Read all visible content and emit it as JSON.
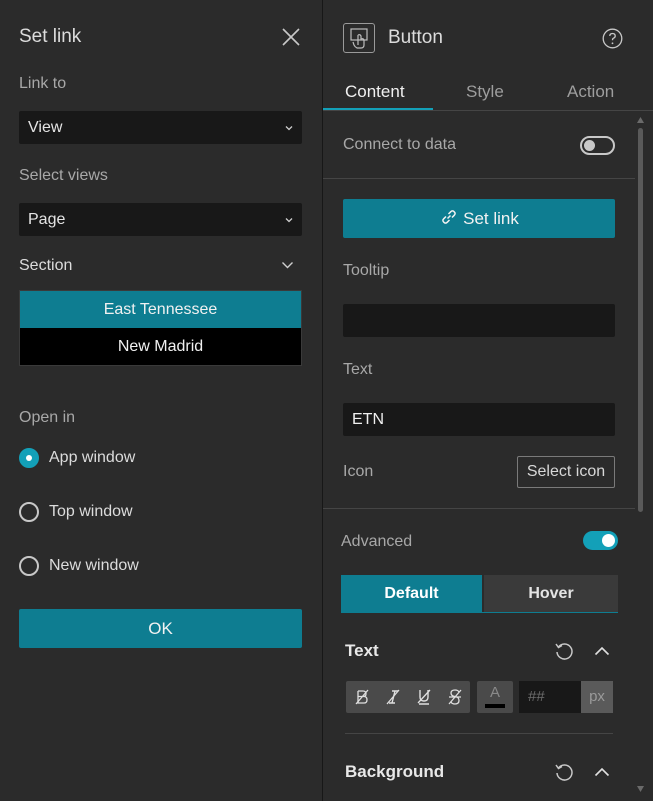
{
  "set_link": {
    "title": "Set link",
    "link_to_label": "Link to",
    "link_to_value": "View",
    "select_views_label": "Select views",
    "select_views_value": "Page",
    "section_label": "Section",
    "sections": [
      "East Tennessee",
      "New Madrid"
    ],
    "selected_section": "East Tennessee",
    "open_in_label": "Open in",
    "open_in_options": [
      "App window",
      "Top window",
      "New window"
    ],
    "open_in_selected": "App window",
    "ok_label": "OK"
  },
  "button_panel": {
    "title": "Button",
    "tabs": [
      "Content",
      "Style",
      "Action"
    ],
    "active_tab": "Content",
    "connect_to_data_label": "Connect to data",
    "connect_to_data_enabled": false,
    "set_link_label": "Set link",
    "tooltip_label": "Tooltip",
    "tooltip_value": "",
    "text_label": "Text",
    "text_value": "ETN",
    "icon_label": "Icon",
    "select_icon_label": "Select icon",
    "advanced_label": "Advanced",
    "advanced_enabled": true,
    "states": [
      "Default",
      "Hover"
    ],
    "active_state": "Default",
    "text_section_title": "Text",
    "font_size_placeholder": "##",
    "font_size_unit": "px",
    "background_section_title": "Background"
  },
  "colors": {
    "accent": "#0e7d91",
    "toggle_on": "#13a0b8",
    "panel_bg": "#2b2b2b",
    "field_bg": "#181818"
  }
}
